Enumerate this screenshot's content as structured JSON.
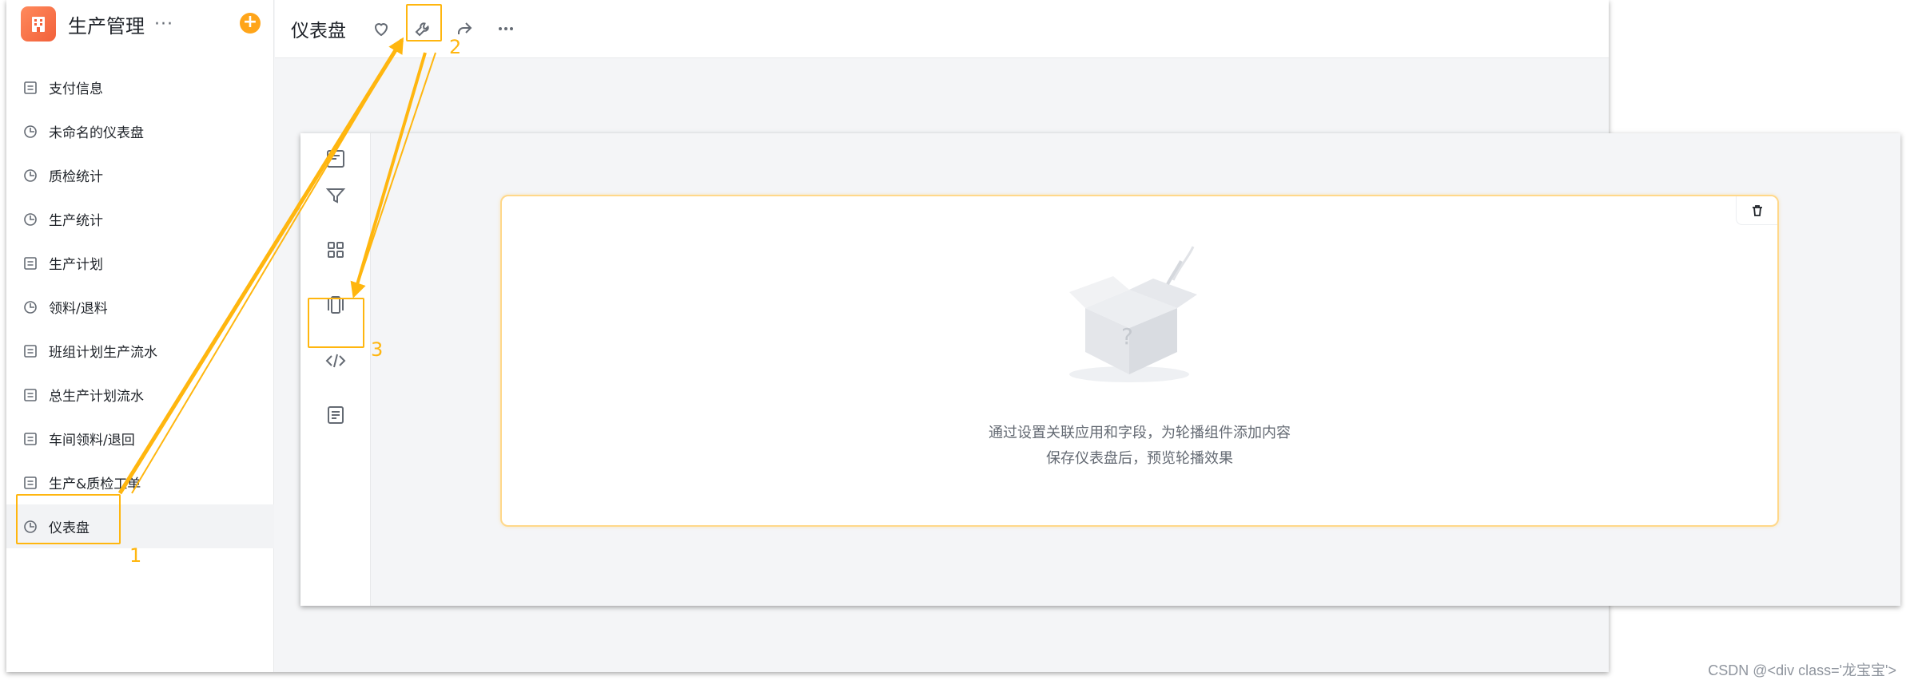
{
  "app": {
    "title": "生产管理",
    "more_label": "···",
    "add_label": "+",
    "colors": {
      "brand": "#f2603a",
      "add": "#ffa51a",
      "annotation": "#ffb60f"
    }
  },
  "sidebar": {
    "items": [
      {
        "label": "支付信息",
        "icon": "form-icon"
      },
      {
        "label": "未命名的仪表盘",
        "icon": "dashboard-icon"
      },
      {
        "label": "质检统计",
        "icon": "dashboard-icon"
      },
      {
        "label": "生产统计",
        "icon": "dashboard-icon"
      },
      {
        "label": "生产计划",
        "icon": "form-icon"
      },
      {
        "label": "领料/退料",
        "icon": "dashboard-icon"
      },
      {
        "label": "班组计划生产流水",
        "icon": "form-icon"
      },
      {
        "label": "总生产计划流水",
        "icon": "form-icon"
      },
      {
        "label": "车间领料/退回",
        "icon": "form-icon"
      },
      {
        "label": "生产&质检工单",
        "icon": "form-icon"
      },
      {
        "label": "仪表盘",
        "icon": "dashboard-icon",
        "active": true
      }
    ]
  },
  "header": {
    "title": "仪表盘",
    "actions": [
      "heart-icon",
      "wrench-icon",
      "share-icon",
      "more-icon"
    ]
  },
  "toolrail": {
    "tools": [
      "text-card-icon",
      "filter-icon",
      "grid-icon",
      "carousel-icon",
      "code-icon",
      "article-icon"
    ]
  },
  "widget": {
    "empty_line1": "通过设置关联应用和字段，为轮播组件添加内容",
    "empty_line2": "保存仪表盘后，预览轮播效果"
  },
  "annotations": {
    "step1": "1",
    "step2": "2",
    "step3": "3"
  },
  "watermark": "CSDN @<div class='龙宝宝'>"
}
